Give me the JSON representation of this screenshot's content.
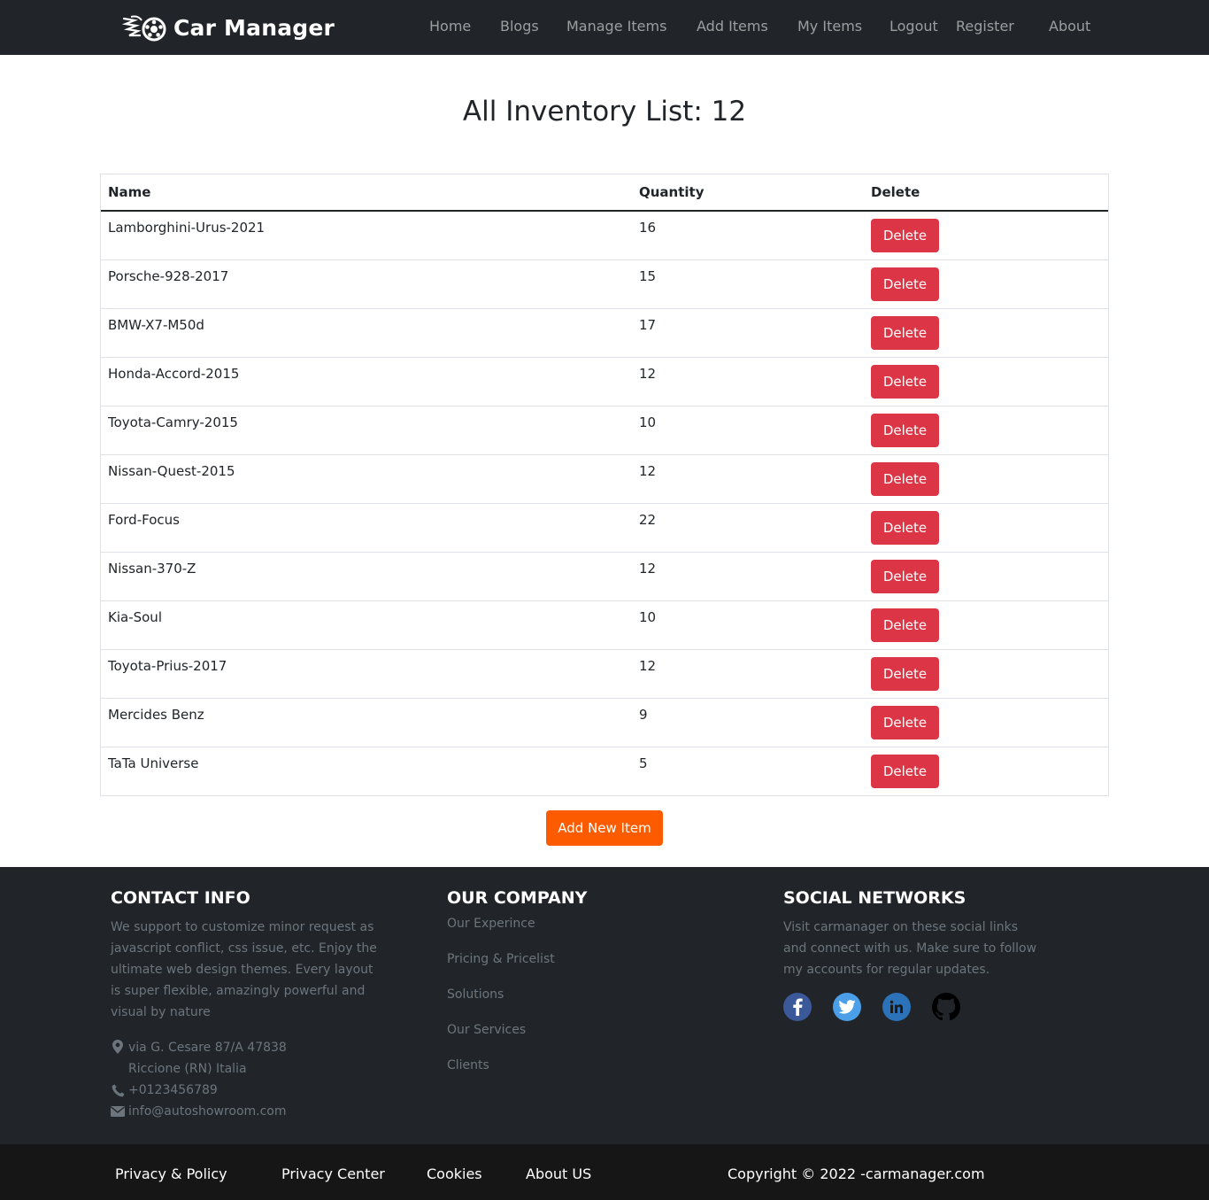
{
  "navbar": {
    "brand": "Car Manager",
    "links": [
      "Home",
      "Blogs",
      "Manage Items",
      "Add Items",
      "My Items",
      "Logout",
      "Register",
      "About"
    ]
  },
  "main": {
    "title": "All Inventory List: 12",
    "table": {
      "headers": [
        "Name",
        "Quantity",
        "Delete"
      ],
      "rows": [
        {
          "name": "Lamborghini-Urus-2021",
          "quantity": "16",
          "action": "Delete"
        },
        {
          "name": "Porsche-928-2017",
          "quantity": "15",
          "action": "Delete"
        },
        {
          "name": "BMW-X7-M50d",
          "quantity": "17",
          "action": "Delete"
        },
        {
          "name": "Honda-Accord-2015",
          "quantity": "12",
          "action": "Delete"
        },
        {
          "name": "Toyota-Camry-2015",
          "quantity": "10",
          "action": "Delete"
        },
        {
          "name": "Nissan-Quest-2015",
          "quantity": "12",
          "action": "Delete"
        },
        {
          "name": "Ford-Focus",
          "quantity": "22",
          "action": "Delete"
        },
        {
          "name": "Nissan-370-Z",
          "quantity": "12",
          "action": "Delete"
        },
        {
          "name": "Kia-Soul",
          "quantity": "10",
          "action": "Delete"
        },
        {
          "name": "Toyota-Prius-2017",
          "quantity": "12",
          "action": "Delete"
        },
        {
          "name": "Mercides Benz",
          "quantity": "9",
          "action": "Delete"
        },
        {
          "name": "TaTa Universe",
          "quantity": "5",
          "action": "Delete"
        }
      ]
    },
    "add_button": "Add New Item"
  },
  "footer": {
    "contact": {
      "heading": "CONTACT INFO",
      "text": "We support to customize minor request as javascript conflict, css issue, etc. Enjoy the ultimate web design themes. Every layout is super flexible, amazingly powerful and visual by nature",
      "address": "via G. Cesare 87/A 47838 Riccione (RN) Italia",
      "phone": "+0123456789",
      "email": "info@autoshowroom.com"
    },
    "company": {
      "heading": "OUR COMPANY",
      "links": [
        "Our Experince",
        "Pricing & Pricelist",
        "Solutions",
        "Our Services",
        "Clients"
      ]
    },
    "social": {
      "heading": "SOCIAL NETWORKS",
      "text": "Visit carmanager on these social links and connect with us. Make sure to follow my accounts for regular updates.",
      "icons": [
        "facebook-icon",
        "twitter-icon",
        "linkedin-icon",
        "github-icon"
      ]
    }
  },
  "bottom": {
    "links": [
      "Privacy & Policy",
      "Privacy Center",
      "Cookies",
      "About US"
    ],
    "copyright": "Copyright © 2022 -carmanager.com"
  },
  "colors": {
    "navbar": "#212529",
    "delete": "#dc3545",
    "add": "#fd5b00",
    "facebook": "#3b5998",
    "twitter": "#1da1f2",
    "linkedin": "#0077b5"
  }
}
